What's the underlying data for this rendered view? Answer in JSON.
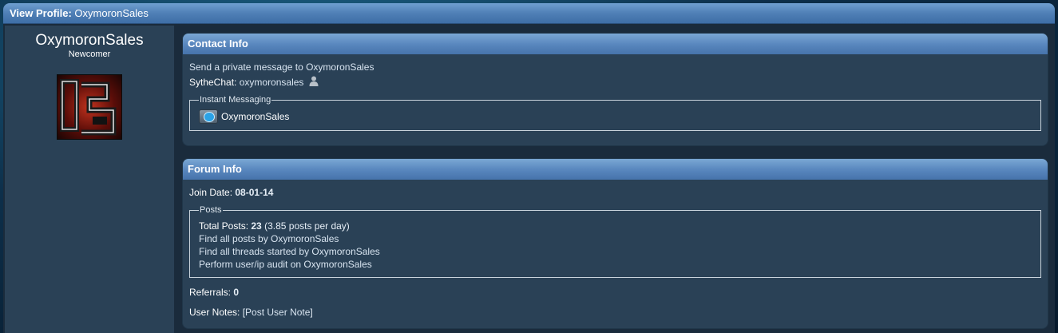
{
  "title_bar": {
    "label": "View Profile:",
    "value": "OxymoronSales"
  },
  "user": {
    "name": "OxymoronSales",
    "title": "Newcomer",
    "avatar_icon": "oxymoron-logo-avatar"
  },
  "contact": {
    "header": "Contact Info",
    "pm_link": "Send a private message to OxymoronSales",
    "sythechat_label": "SytheChat:",
    "sythechat_value": "oxymoronsales",
    "im_legend": "Instant Messaging",
    "skype_name": "OxymoronSales"
  },
  "forum": {
    "header": "Forum Info",
    "join_label": "Join Date:",
    "join_value": "08-01-14",
    "posts_legend": "Posts",
    "total_label": "Total Posts:",
    "total_value": "23",
    "per_day": "(3.85 posts per day)",
    "find_posts": "Find all posts by OxymoronSales",
    "find_threads": "Find all threads started by OxymoronSales",
    "audit": "Perform user/ip audit on OxymoronSales",
    "referrals_label": "Referrals:",
    "referrals_value": "0",
    "notes_label": "User Notes:",
    "notes_link": "Post User Note"
  }
}
